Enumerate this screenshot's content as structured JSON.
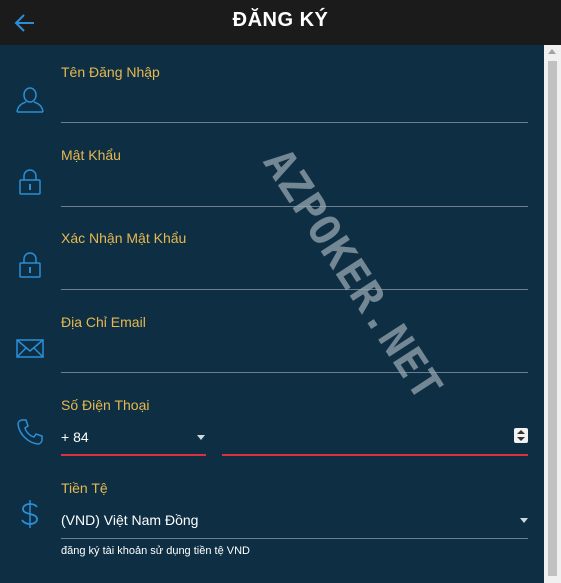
{
  "header": {
    "title": "ĐĂNG KÝ",
    "back_icon": "arrow-left-icon"
  },
  "fields": {
    "username": {
      "label": "Tên Đăng Nhập",
      "icon": "user-icon"
    },
    "password": {
      "label": "Mật Khẩu",
      "icon": "lock-icon"
    },
    "confirm_password": {
      "label": "Xác Nhận Mật Khẩu",
      "icon": "lock-icon"
    },
    "email": {
      "label": "Địa Chỉ Email",
      "icon": "envelope-icon"
    },
    "phone": {
      "label": "Số Điện Thoại",
      "icon": "phone-icon",
      "country_code": "+ 84"
    },
    "currency": {
      "label": "Tiền Tệ",
      "icon": "dollar-icon",
      "selected": "(VND) Việt Nam Đồng",
      "hint": "đăng ký tài khoản sử dụng tiền tệ VND"
    }
  },
  "watermark": "AZPOKER.NET",
  "colors": {
    "background": "#0e2f43",
    "header": "#1b1b1b",
    "label": "#e6b850",
    "accent": "#2a8fd6",
    "error_underline": "#d9323f"
  }
}
